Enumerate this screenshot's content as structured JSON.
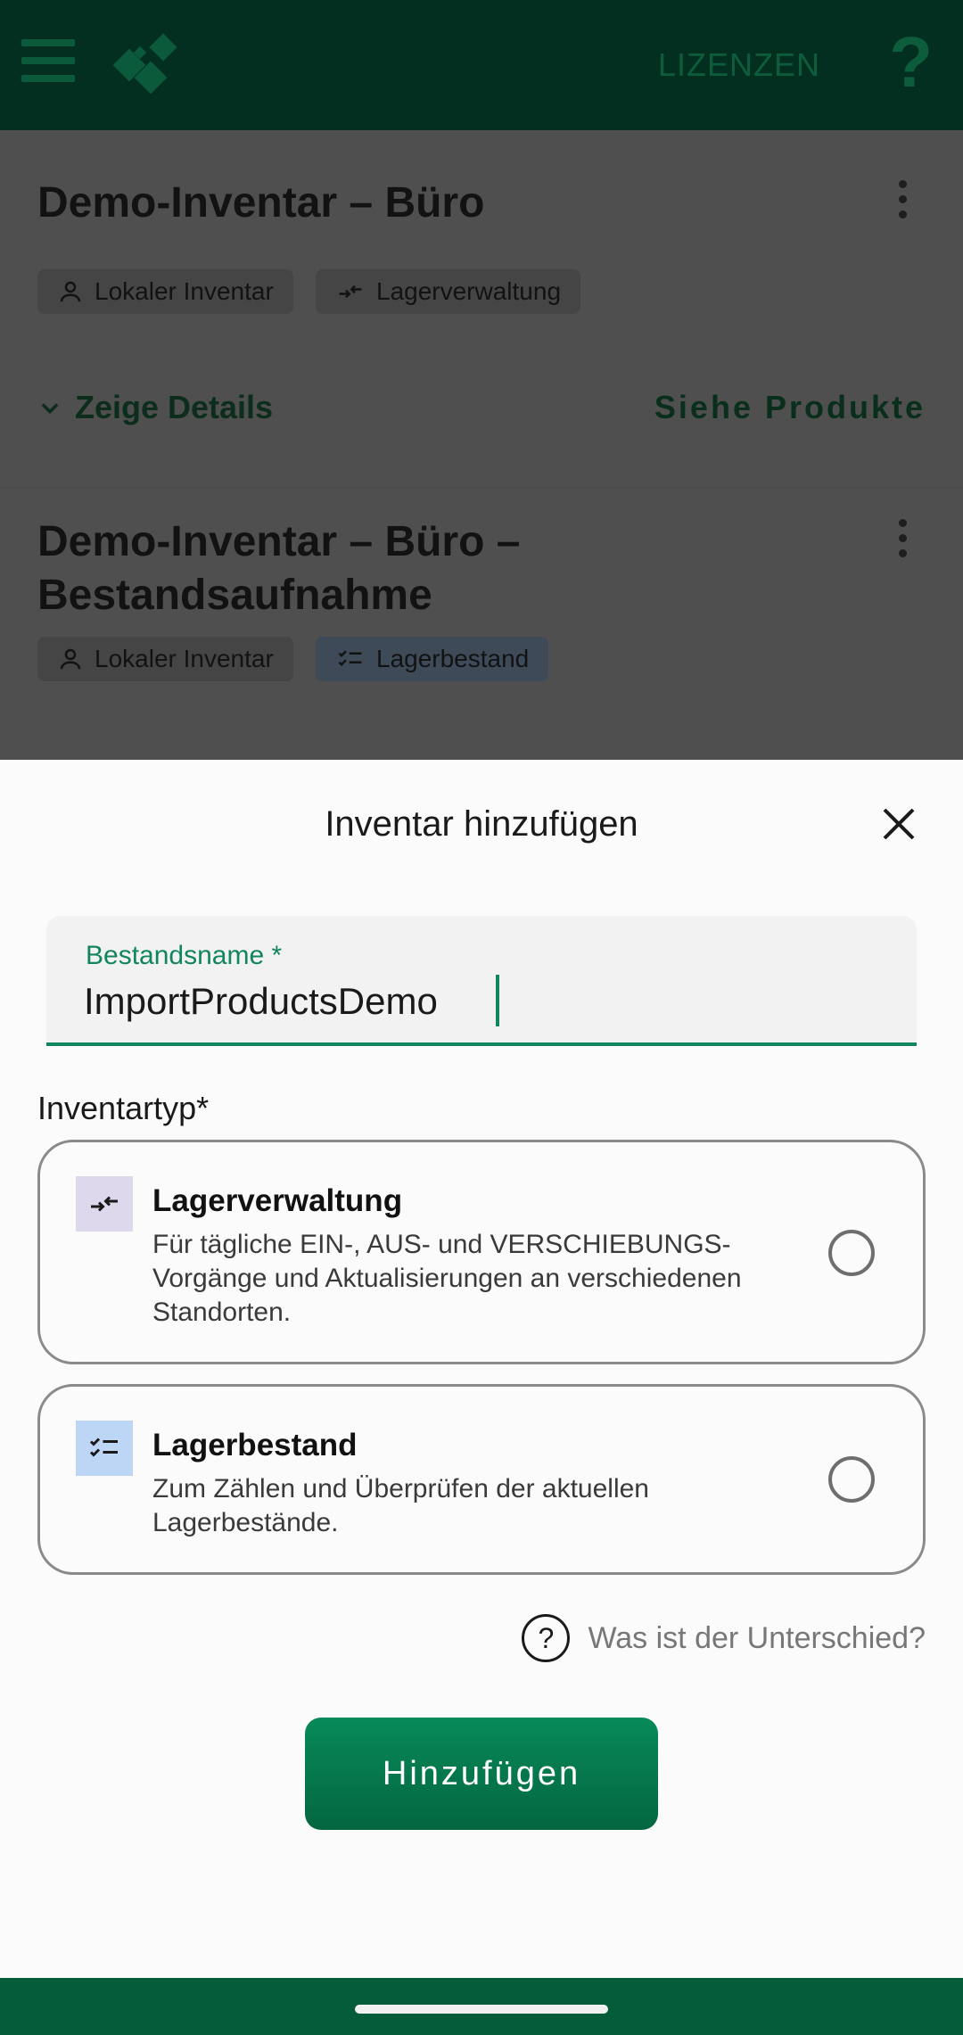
{
  "appbar": {
    "licenses_label": "LIZENZEN",
    "help_label": "?"
  },
  "inventories": [
    {
      "title": "Demo-Inventar – Büro",
      "chips": [
        "Lokaler Inventar",
        "Lagerverwaltung"
      ],
      "details_label": "Zeige Details",
      "products_label": "Siehe Produkte"
    },
    {
      "title": "Demo-Inventar – Büro – Bestandsaufnahme",
      "chips": [
        "Lokaler Inventar",
        "Lagerbestand"
      ]
    }
  ],
  "sheet": {
    "title": "Inventar hinzufügen",
    "name_field": {
      "label": "Bestandsname *",
      "value": "ImportProductsDemo"
    },
    "type_label": "Inventartyp*",
    "options": [
      {
        "title": "Lagerverwaltung",
        "description": "Für tägliche EIN-, AUS- und VERSCHIEBUNGS-Vorgänge und Aktualisierungen an verschiedenen Standorten.",
        "selected": false
      },
      {
        "title": "Lagerbestand",
        "description": "Zum Zählen und Überprüfen der aktuellen Lagerbestände.",
        "selected": false
      }
    ],
    "difference_label": "Was ist der Unterschied?",
    "add_button_label": "Hinzufügen"
  },
  "colors": {
    "primary": "#11855b",
    "appbar": "#022f1f",
    "button": "#078a59"
  }
}
